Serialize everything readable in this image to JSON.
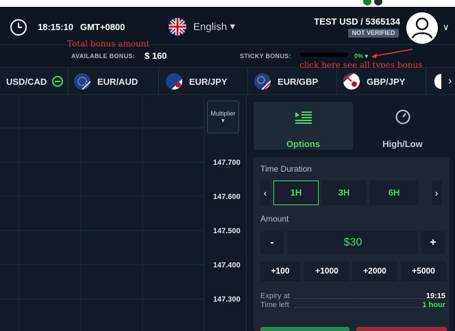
{
  "header": {
    "time": "18:15:10",
    "timezone": "GMT+0800",
    "language": "English",
    "account": "TEST USD / 5365134",
    "verification": "NOT VERIFIED"
  },
  "bonus": {
    "annotation_total": "Total bonus amount",
    "available_label": "AVAILABLE BONUS:",
    "available_value": "$ 160",
    "sticky_label": "STICKY BONUS:",
    "sticky_value": "0%",
    "annotation_sticky": "click here see all types bonus"
  },
  "pairs": [
    {
      "label": "USD/CAD"
    },
    {
      "label": "EUR/AUD"
    },
    {
      "label": "EUR/JPY"
    },
    {
      "label": "EUR/GBP"
    },
    {
      "label": "GBP/JPY"
    }
  ],
  "chart": {
    "multiplier_label": "Multiplier",
    "prices": [
      "147.700",
      "147.600",
      "147.500",
      "147.400",
      "147.300"
    ]
  },
  "panel": {
    "tabs": [
      {
        "label": "Options"
      },
      {
        "label": "High/Low"
      }
    ],
    "time_duration_label": "Time Duration",
    "durations": [
      "1H",
      "3H",
      "6H"
    ],
    "amount_label": "Amount",
    "amount_value": "$30",
    "minus_label": "-",
    "plus_label": "+",
    "quick_amounts": [
      "+100",
      "+1000",
      "+2000",
      "+5000"
    ],
    "expiry_label": "Expiry at",
    "expiry_value": "19:15",
    "time_left_label": "Time left",
    "time_left_value": "1 hour"
  },
  "colors": {
    "accent_green": "#4cd964",
    "annotation_red": "#e53935",
    "background": "#0f1a26"
  }
}
